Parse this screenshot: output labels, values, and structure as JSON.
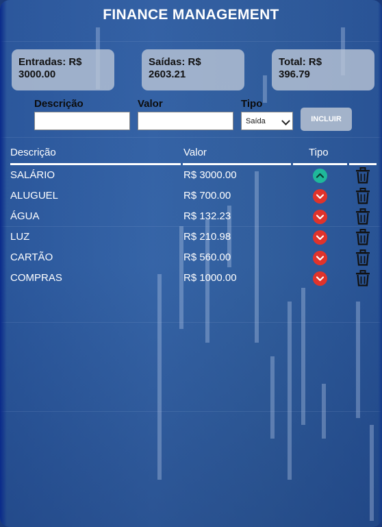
{
  "header": {
    "title": "FINANCE MANAGEMENT"
  },
  "summary": {
    "income": {
      "label": "Entradas: R$",
      "value": "3000.00"
    },
    "expenses": {
      "label": "Saídas: R$",
      "value": "2603.21"
    },
    "total": {
      "label": "Total: R$",
      "value": "396.79"
    }
  },
  "form": {
    "description_label": "Descrição",
    "description_value": "",
    "value_label": "Valor",
    "value_value": "",
    "type_label": "Tipo",
    "type_selected": "Saída",
    "submit_label": "INCLUIR"
  },
  "table": {
    "columns": [
      "Descrição",
      "Valor",
      "Tipo"
    ],
    "rows": [
      {
        "description": "SALÁRIO",
        "value": "R$ 3000.00",
        "type": "in",
        "type_icon": "chevron-up-circle-icon"
      },
      {
        "description": "ALUGUEL",
        "value": "R$ 700.00",
        "type": "out",
        "type_icon": "chevron-down-circle-icon"
      },
      {
        "description": "ÁGUA",
        "value": "R$ 132.23",
        "type": "out",
        "type_icon": "chevron-down-circle-icon"
      },
      {
        "description": "LUZ",
        "value": "R$ 210.98",
        "type": "out",
        "type_icon": "chevron-down-circle-icon"
      },
      {
        "description": "CARTÃO",
        "value": "R$ 560.00",
        "type": "out",
        "type_icon": "chevron-down-circle-icon"
      },
      {
        "description": "COMPRAS",
        "value": "R$ 1000.00",
        "type": "out",
        "type_icon": "chevron-down-circle-icon"
      }
    ]
  },
  "colors": {
    "income": "#1fb89a",
    "expense": "#e0332b",
    "background": "#34629f"
  }
}
